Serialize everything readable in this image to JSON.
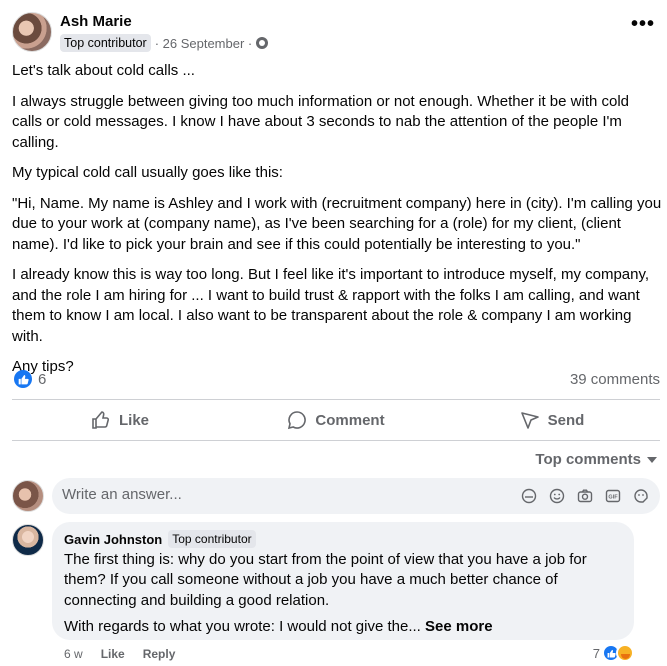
{
  "post": {
    "author": "Ash Marie",
    "badge": "Top contributor",
    "date": "· 26 September ·",
    "more_label": "•••",
    "paragraphs": [
      "Let's talk about cold calls ...",
      "I always struggle between giving too much information or not enough. Whether it be with cold calls or cold messages. I know I have about 3 seconds to nab the attention of the people I'm calling.",
      "My typical cold call usually goes like this:",
      "\"Hi, Name. My name is Ashley and I work with (recruitment company) here in (city). I'm calling you due to your work at (company name), as I've been searching for a (role) for my client, (client name). I'd like to pick your brain and see if this could potentially be interesting to you.\"",
      "I already know this is way too long. But I feel like it's important to introduce myself, my company, and the role I am hiring for ... I want to build trust & rapport with the folks I am calling, and want them to know I am local. I also want to be transparent about the role & company I am working with.",
      "Any tips?"
    ],
    "like_count": "6",
    "comments_count": "39 comments"
  },
  "actions": {
    "like": "Like",
    "comment": "Comment",
    "send": "Send"
  },
  "sort_label": "Top comments",
  "composer": {
    "placeholder": "Write an answer..."
  },
  "comment": {
    "author": "Gavin Johnston",
    "badge": "Top contributor",
    "paragraph1": "The first thing is: why do you start from the point of view that you have a job for them? If you call someone without a job you have a much better chance of connecting and building a good relation.",
    "paragraph2": "With regards to what you wrote: I would not give the...",
    "see_more": "See more",
    "age": "6 w",
    "like_label": "Like",
    "reply_label": "Reply",
    "reaction_count": "7"
  },
  "colors": {
    "accent": "#1877f2",
    "muted": "#65676b",
    "bubble": "#f0f2f5"
  }
}
